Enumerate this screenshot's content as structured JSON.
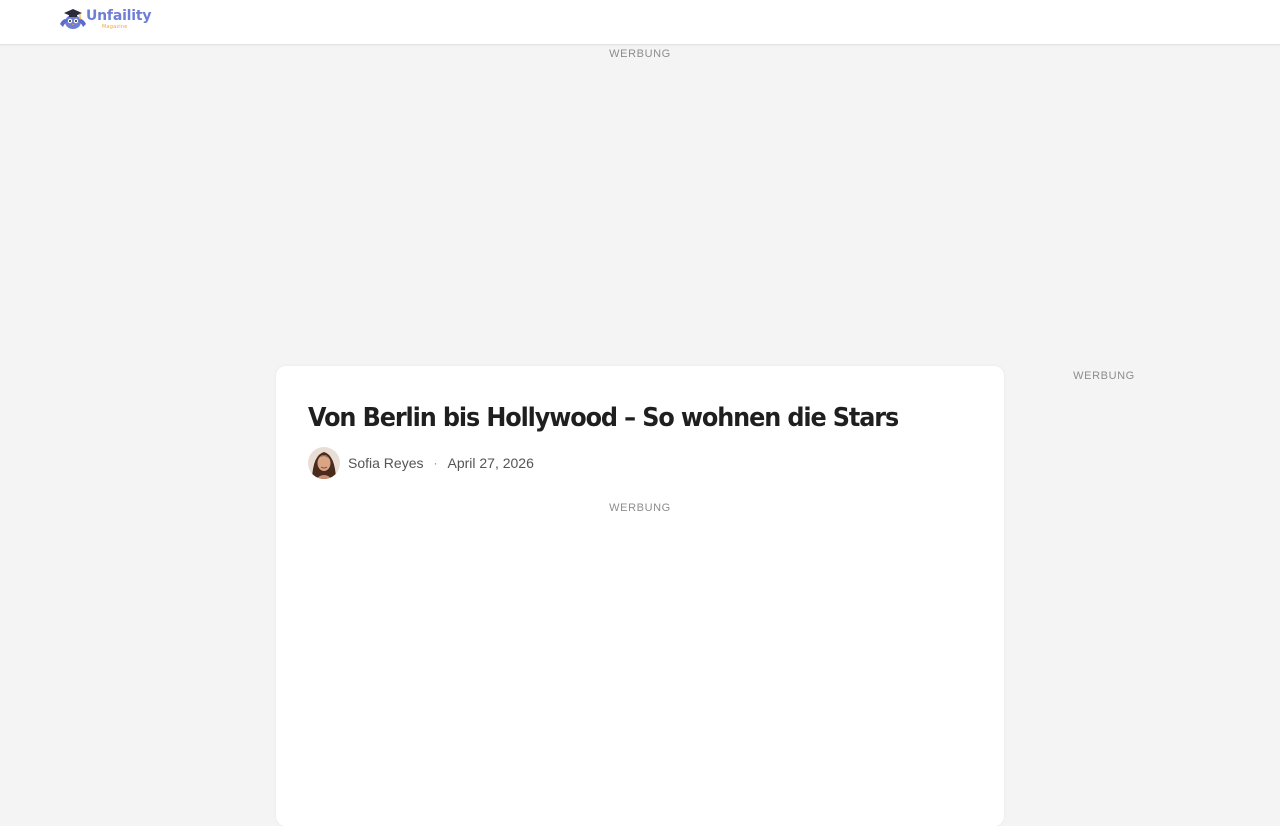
{
  "header": {
    "logo_name": "Unfaility",
    "logo_tagline": "Magazine"
  },
  "ads": {
    "top_label": "WERBUNG",
    "side_label": "WERBUNG",
    "inline_label": "WERBUNG"
  },
  "article": {
    "title": "Von Berlin bis Hollywood – So wohnen die Stars",
    "author": "Sofia Reyes",
    "separator": "·",
    "date": "April 27, 2026"
  },
  "colors": {
    "logo_primary": "#6e7fd6",
    "logo_accent": "#f0a640",
    "page_background": "#f4f4f4",
    "card_background": "#ffffff",
    "title_text": "#1f1f1f"
  },
  "icons": {
    "logo_mascot": "graduation-cap-owl-icon",
    "author_avatar": "avatar"
  }
}
